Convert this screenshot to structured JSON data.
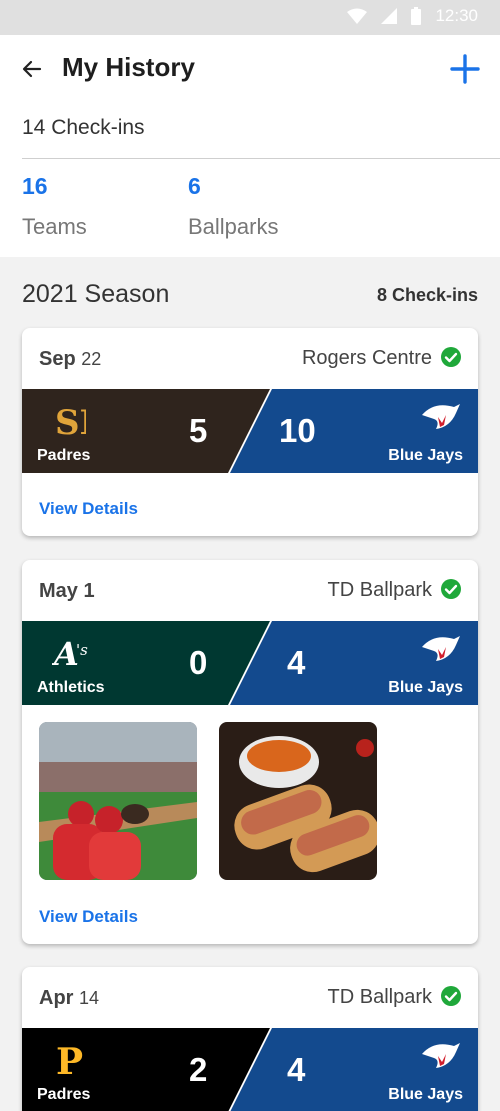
{
  "status_bar": {
    "time": "12:30"
  },
  "header": {
    "title": "My History",
    "checkins_total": "14 Check-ins",
    "stats": [
      {
        "value": "16",
        "label": "Teams"
      },
      {
        "value": "6",
        "label": "Ballparks"
      }
    ]
  },
  "season": {
    "title": "2021 Season",
    "checkins": "8 Check-ins"
  },
  "games": [
    {
      "month": "Sep",
      "day": "22",
      "venue": "Rogers Centre",
      "away": {
        "name": "Padres",
        "score": "5",
        "color": "#2f241d"
      },
      "home": {
        "name": "Blue Jays",
        "score": "10",
        "color": "#134a8e"
      },
      "view_details": "View Details"
    },
    {
      "month": "May 1",
      "day": "",
      "venue": "TD Ballpark",
      "away": {
        "name": "Athletics",
        "score": "0",
        "color": "#003831"
      },
      "home": {
        "name": "Blue Jays",
        "score": "4",
        "color": "#134a8e"
      },
      "view_details": "View Details"
    },
    {
      "month": "Apr",
      "day": "14",
      "venue": "TD Ballpark",
      "away": {
        "name": "Padres",
        "score": "2",
        "color": "#000000"
      },
      "home": {
        "name": "Blue Jays",
        "score": "4",
        "color": "#134a8e"
      }
    }
  ],
  "colors": {
    "accent": "#1a73e8",
    "check": "#1fa83a"
  }
}
